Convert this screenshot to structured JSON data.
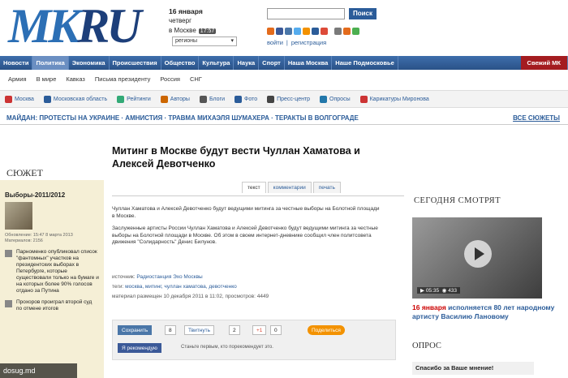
{
  "logo": {
    "mk": "MK",
    "ru": "RU"
  },
  "header": {
    "date": "16 января",
    "weekday": "четверг",
    "city": "в Москве",
    "time": "17:57",
    "region_select": "регионы",
    "search_button": "Поиск",
    "login": "войти",
    "register": "регистрация"
  },
  "nav": [
    "Новости",
    "Политика",
    "Экономика",
    "Происшествия",
    "Общество",
    "Культура",
    "Наука",
    "Спорт",
    "Наша Москва",
    "Наше Подмосковье"
  ],
  "nav_special": "Свежий МК",
  "subnav": [
    "Армия",
    "В мире",
    "Кавказ",
    "Письма президенту",
    "Россия",
    "СНГ"
  ],
  "sections": [
    "Москва",
    "Московская область",
    "Рейтинги",
    "Авторы",
    "Блоги",
    "Фото",
    "Пресс-центр",
    "Опросы",
    "Карикатуры Миронова"
  ],
  "trend": "МАЙДАН: ПРОТЕСТЫ НА УКРАИНЕ  ·  АМНИСТИЯ  ·  ТРАВМА МИХАЭЛЯ ШУМАХЕРА  ·  ТЕРАКТЫ В ВОЛГОГРАДЕ",
  "trend_all": "ВСЕ СЮЖЕТЫ",
  "left": {
    "heading": "СЮЖЕТ",
    "topic": "Выборы-2011/2012",
    "meta1": "Обновление: 15:47 8 марта 2013",
    "meta2": "Материалов: 2156",
    "items": [
      "Парноменко опубликовал список \"фантомных\" участков на президентских выборах в Петербурге, которые существовали только на бумаге и на которых более 90% голосов отдано за Путина",
      "Прохоров проиграл второй суд по отмене итогов"
    ]
  },
  "article": {
    "title": "Митинг в Москве будут вести Чуллан Хаматова и Алексей Девотченко",
    "tabs": [
      "текст",
      "комментарии",
      "печать"
    ],
    "p1": "Чуллан Хаматова и Алексей Девотченко будут ведущими митинга за честные выборы на Болотной площади в Москве.",
    "p2": "Заслуженные артисты России Чуллан Хаматова и Алексей Девотченко будут ведущими митинга за честные выборы на Болотной площади в Москве. Об этом в своем интернет-дневнике сообщил член политсовета движения \"Солидарность\" Денис Билунов.",
    "source_label": "источник:",
    "source": "Радиостанция Эхо Москвы",
    "tags_label": "теги:",
    "tags": "москва, митинг, чуллан хаматова, девотченко",
    "published": "материал размещен 10 декабря 2011 в 11:02, просмотров: 4449",
    "share": {
      "save": "Сохранить",
      "save_count": "8",
      "tweet": "Твитнуть",
      "tweet_count": "2",
      "gplus": "+1",
      "gplus_count": "0",
      "share": "Поделиться",
      "fb": "Я рекомендую",
      "fb_text": "Станьте первым, кто порекомендует это."
    }
  },
  "right": {
    "heading": "СЕГОДНЯ СМОТРЯТ",
    "video_time": "05:35",
    "video_views": "433",
    "caption_date": "16 января",
    "caption": "исполняется 80 лет народному артисту Василию Лановому",
    "poll_heading": "ОПРОС",
    "poll_question": "Спасибо за Ваше мнение!"
  },
  "watermark": "dosug.md"
}
